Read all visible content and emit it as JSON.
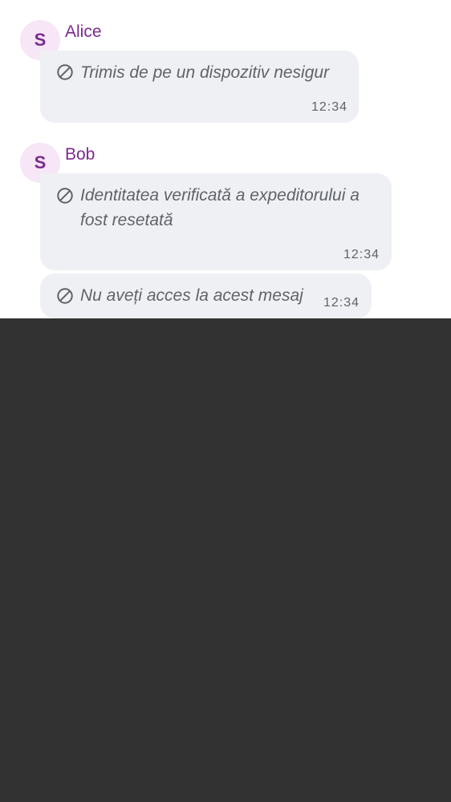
{
  "colors": {
    "sender_name": "#7d2a8e",
    "avatar_bg": "#f6e6f6",
    "bubble_bg": "#eff0f4",
    "muted_text": "#5f6368",
    "backdrop": "#323232"
  },
  "messages": [
    {
      "sender": "Alice",
      "avatar_initial": "S",
      "icon": "blocked-icon",
      "text": "Trimis de pe un dispozitiv nesigur",
      "time": "12:34"
    },
    {
      "sender": "Bob",
      "avatar_initial": "S",
      "icon": "blocked-icon",
      "text_line1": "Identitatea verificată a expeditorului a",
      "text_line2": "fost resetată",
      "time": "12:34"
    },
    {
      "icon": "blocked-icon",
      "text": "Nu aveți acces la acest mesaj",
      "time": "12:34"
    }
  ]
}
